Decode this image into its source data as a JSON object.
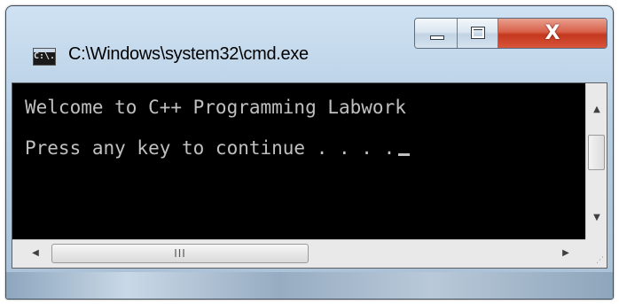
{
  "window": {
    "title": "C:\\Windows\\system32\\cmd.exe",
    "app_icon_text": "C:\\."
  },
  "caption_buttons": {
    "minimize_icon": "minimize-icon",
    "maximize_icon": "maximize-icon",
    "close_label": "X"
  },
  "console": {
    "lines": [
      "Welcome to C++ Programming Labwork",
      "Press any key to continue . . . ."
    ],
    "text_color": "#c0c0c0",
    "background": "#000000"
  },
  "scrollbars": {
    "up_arrow": "▲",
    "down_arrow": "▼",
    "left_arrow": "◀",
    "right_arrow": "▶",
    "thumb_grip": "III",
    "size_grip": "⋰"
  },
  "colors": {
    "close_button": "#c4381e",
    "frame": "#b6cde2"
  }
}
